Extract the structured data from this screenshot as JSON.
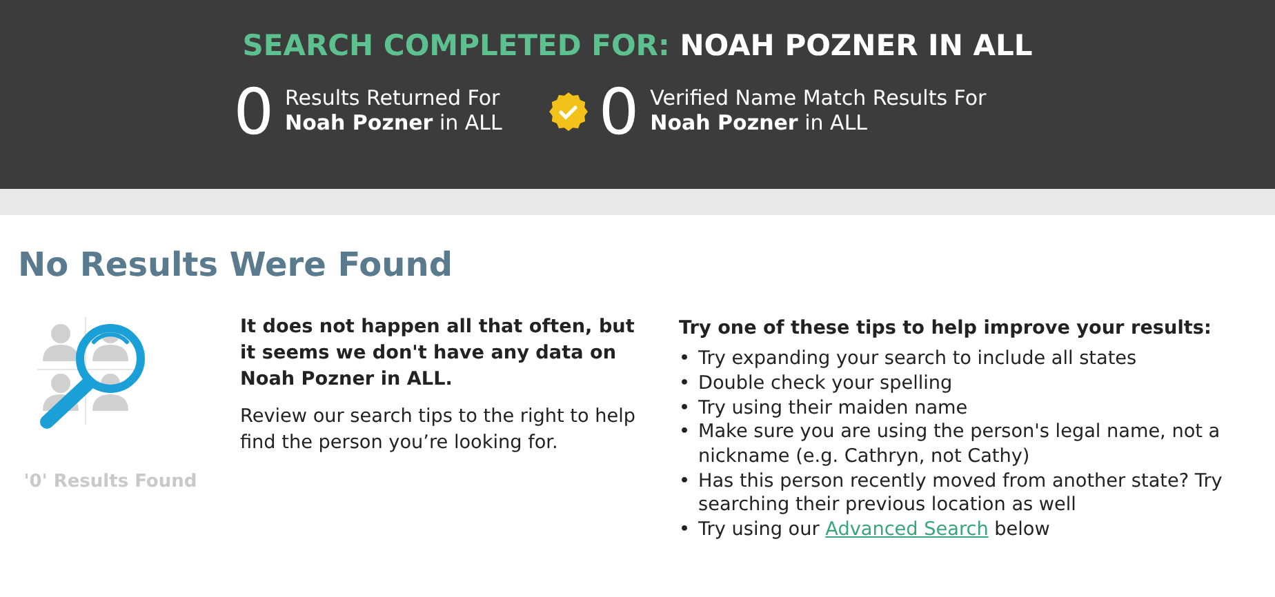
{
  "header": {
    "label": "SEARCH COMPLETED FOR:",
    "query": "NOAH POZNER IN ALL"
  },
  "stats": [
    {
      "kind": "plain",
      "count": "0",
      "label": "Results Returned For",
      "detail": "**Noah Pozner** in ALL"
    },
    {
      "kind": "verified",
      "count": "0",
      "label": "Verified Name Match Results For",
      "detail": "**Noah Pozner** in ALL"
    }
  ],
  "heading": "No Results Were Found",
  "illustration": {
    "caption": "'0' Results Found"
  },
  "message": {
    "lead": "It does not happen all that often, but it seems we don't have any data on Noah Pozner in ALL.",
    "body": "Review our search tips to the right to help find the person you’re looking for."
  },
  "tips": {
    "title": "Try one of these tips to help improve your results:",
    "items": [
      {
        "marker": "•",
        "text": "Try expanding your search to include all states"
      },
      {
        "marker": "•",
        "text": "Double check your spelling"
      },
      {
        "marker": "•",
        "text": "Try using their maiden name"
      },
      {
        "marker": "•",
        "text": "Make sure you are using the person's legal name, not a nickname (e.g. Cathryn, not Cathy)"
      },
      {
        "marker": "•",
        "text": "Has this person recently moved from another state? Try searching their previous location as well"
      },
      {
        "marker": "•",
        "text": "Try using our",
        "link": "Advanced Search",
        "after": "below"
      }
    ]
  }
}
